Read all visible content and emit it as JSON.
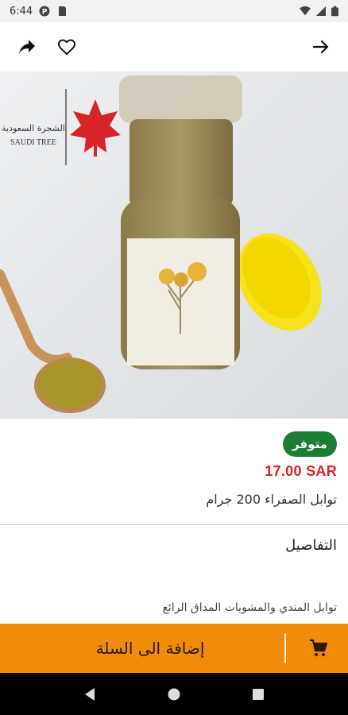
{
  "status_bar": {
    "time": "6:44"
  },
  "app_bar": {
    "share_icon": "share-icon",
    "favorite_icon": "heart-icon",
    "back_icon": "arrow-right-icon"
  },
  "product": {
    "image_logo_text_ar": "الشجرة السعودية",
    "image_logo_text_en": "SAUDI TREE",
    "availability": "متوفر",
    "price": "17.00 SAR",
    "name": "توابل الصفراء 200 جرام"
  },
  "details": {
    "heading": "التفاصيل",
    "description": "توابل المندي والمشويات المداق الرائع"
  },
  "cart": {
    "label": "إضافة الى السلة",
    "icon": "cart-icon"
  },
  "colors": {
    "accent": "#f08c0a",
    "badge": "#1e7d34",
    "price": "#e02020"
  }
}
